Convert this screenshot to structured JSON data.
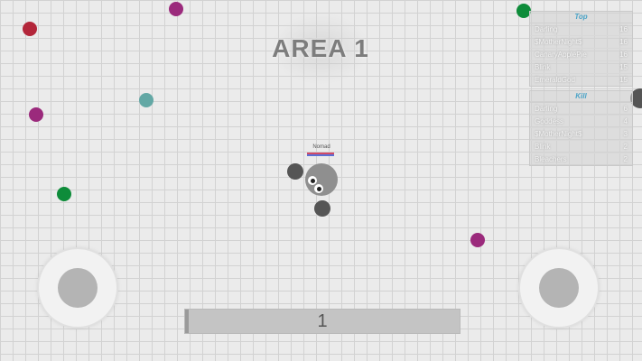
{
  "area": {
    "title": "AREA 1"
  },
  "leaderboard": {
    "title": "Top",
    "rows": [
      {
        "name": "Darling",
        "score": "16"
      },
      {
        "name": "$MotherNight$",
        "score": "16"
      },
      {
        "name": "CanaryApplePie",
        "score": "16"
      },
      {
        "name": "Blink",
        "score": "15"
      },
      {
        "name": "EmeraldGod",
        "score": "15"
      }
    ]
  },
  "killboard": {
    "title": "Kill",
    "rows": [
      {
        "name": "Darling",
        "score": "6"
      },
      {
        "name": "Goddess",
        "score": "4"
      },
      {
        "name": "$MotherNight$",
        "score": "3"
      },
      {
        "name": "Blink",
        "score": "2"
      },
      {
        "name": "Bleachers",
        "score": "2"
      }
    ]
  },
  "player": {
    "name": "Nomad",
    "color": "#8f8f8f"
  },
  "score_bar": {
    "value": "1",
    "progress": 0.01
  },
  "colors": {
    "background": "#ebebeb",
    "grid": "#d2d2d2",
    "red": "#b3263a",
    "purple": "#9b2a7c",
    "teal": "#63a8a5",
    "green": "#0e8c3a",
    "dark": "#555555"
  }
}
